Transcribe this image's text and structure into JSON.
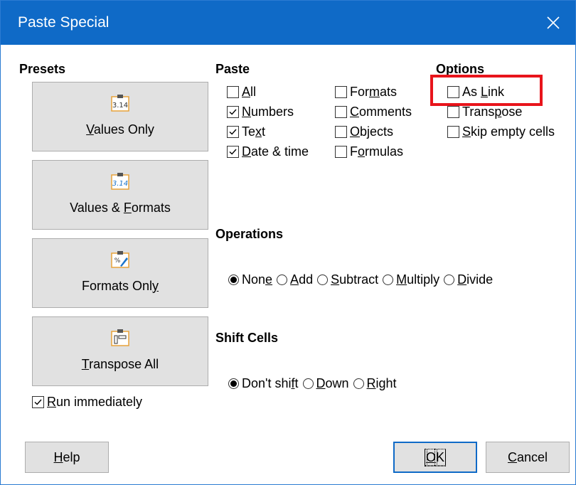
{
  "window": {
    "title": "Paste Special"
  },
  "presets": {
    "heading": "Presets",
    "items": [
      {
        "label_pre": "",
        "label_key": "V",
        "label_post": "alues Only",
        "icon": "paste-values-icon"
      },
      {
        "label_pre": "Values & ",
        "label_key": "F",
        "label_post": "ormats",
        "icon": "paste-values-formats-icon"
      },
      {
        "label_pre": "Formats Onl",
        "label_key": "y",
        "label_post": "",
        "icon": "paste-formats-icon"
      },
      {
        "label_pre": "",
        "label_key": "T",
        "label_post": "ranspose All",
        "icon": "paste-transpose-icon"
      }
    ],
    "run_immediately": {
      "label_pre": "",
      "label_key": "R",
      "label_post": "un immediately",
      "checked": true
    }
  },
  "paste": {
    "heading": "Paste",
    "col1": [
      {
        "pre": "",
        "key": "A",
        "post": "ll",
        "checked": false
      },
      {
        "pre": "",
        "key": "N",
        "post": "umbers",
        "checked": true
      },
      {
        "pre": "Te",
        "key": "x",
        "post": "t",
        "checked": true
      },
      {
        "pre": "",
        "key": "D",
        "post": "ate & time",
        "checked": true
      }
    ],
    "col2": [
      {
        "pre": "For",
        "key": "m",
        "post": "ats",
        "checked": false
      },
      {
        "pre": "",
        "key": "C",
        "post": "omments",
        "checked": false
      },
      {
        "pre": "",
        "key": "O",
        "post": "bjects",
        "checked": false
      },
      {
        "pre": "F",
        "key": "o",
        "post": "rmulas",
        "checked": false
      }
    ]
  },
  "options": {
    "heading": "Options",
    "items": [
      {
        "pre": "As ",
        "key": "L",
        "post": "ink",
        "checked": false
      },
      {
        "pre": "Trans",
        "key": "p",
        "post": "ose",
        "checked": false
      },
      {
        "pre": "",
        "key": "S",
        "post": "kip empty cells",
        "checked": false
      }
    ]
  },
  "operations": {
    "heading": "Operations",
    "items": [
      {
        "pre": "Non",
        "key": "e",
        "post": "",
        "selected": true
      },
      {
        "pre": "",
        "key": "A",
        "post": "dd",
        "selected": false
      },
      {
        "pre": "",
        "key": "S",
        "post": "ubtract",
        "selected": false
      },
      {
        "pre": "",
        "key": "M",
        "post": "ultiply",
        "selected": false
      },
      {
        "pre": "",
        "key": "D",
        "post": "ivide",
        "selected": false
      }
    ]
  },
  "shift_cells": {
    "heading": "Shift Cells",
    "items": [
      {
        "pre": "Don't shi",
        "key": "f",
        "post": "t",
        "selected": true
      },
      {
        "pre": "",
        "key": "D",
        "post": "own",
        "selected": false
      },
      {
        "pre": "",
        "key": "R",
        "post": "ight",
        "selected": false
      }
    ]
  },
  "buttons": {
    "help": {
      "pre": "",
      "key": "H",
      "post": "elp"
    },
    "ok": {
      "pre": "",
      "key": "O",
      "post": "K"
    },
    "cancel": {
      "pre": "",
      "key": "C",
      "post": "ancel"
    }
  },
  "colors": {
    "titlebar": "#0f6ac7",
    "highlight": "#e8141b",
    "button_face": "#e1e1e1"
  }
}
